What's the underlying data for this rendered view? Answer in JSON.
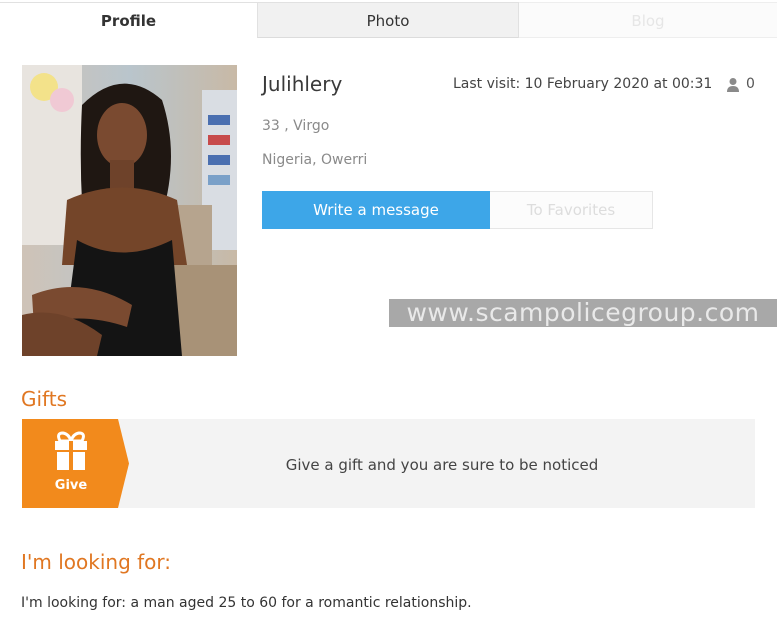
{
  "tabs": [
    {
      "label": "Profile",
      "active": true
    },
    {
      "label": "Photo",
      "active": false
    },
    {
      "label": "Blog",
      "active": false
    }
  ],
  "profile": {
    "username": "Julihlery",
    "last_visit": "Last visit: 10 February 2020 at 00:31",
    "visit_count": "0",
    "age_sign": "33 , Virgo",
    "location": "Nigeria, Owerri"
  },
  "actions": {
    "message_label": "Write a message",
    "favorites_label": "To Favorites"
  },
  "watermark": "www.scampolicegroup.com",
  "gifts": {
    "heading": "Gifts",
    "give_label": "Give",
    "text": "Give a gift and you are sure to be noticed"
  },
  "looking_for": {
    "heading": "I'm looking for:",
    "text": "I'm looking for: a man aged 25 to 60 for a romantic relationship."
  },
  "colors": {
    "accent_blue": "#3da6e8",
    "heading_orange": "#e07722",
    "gift_orange": "#f28a1c"
  },
  "icons": [
    "user-icon",
    "gift-icon"
  ]
}
